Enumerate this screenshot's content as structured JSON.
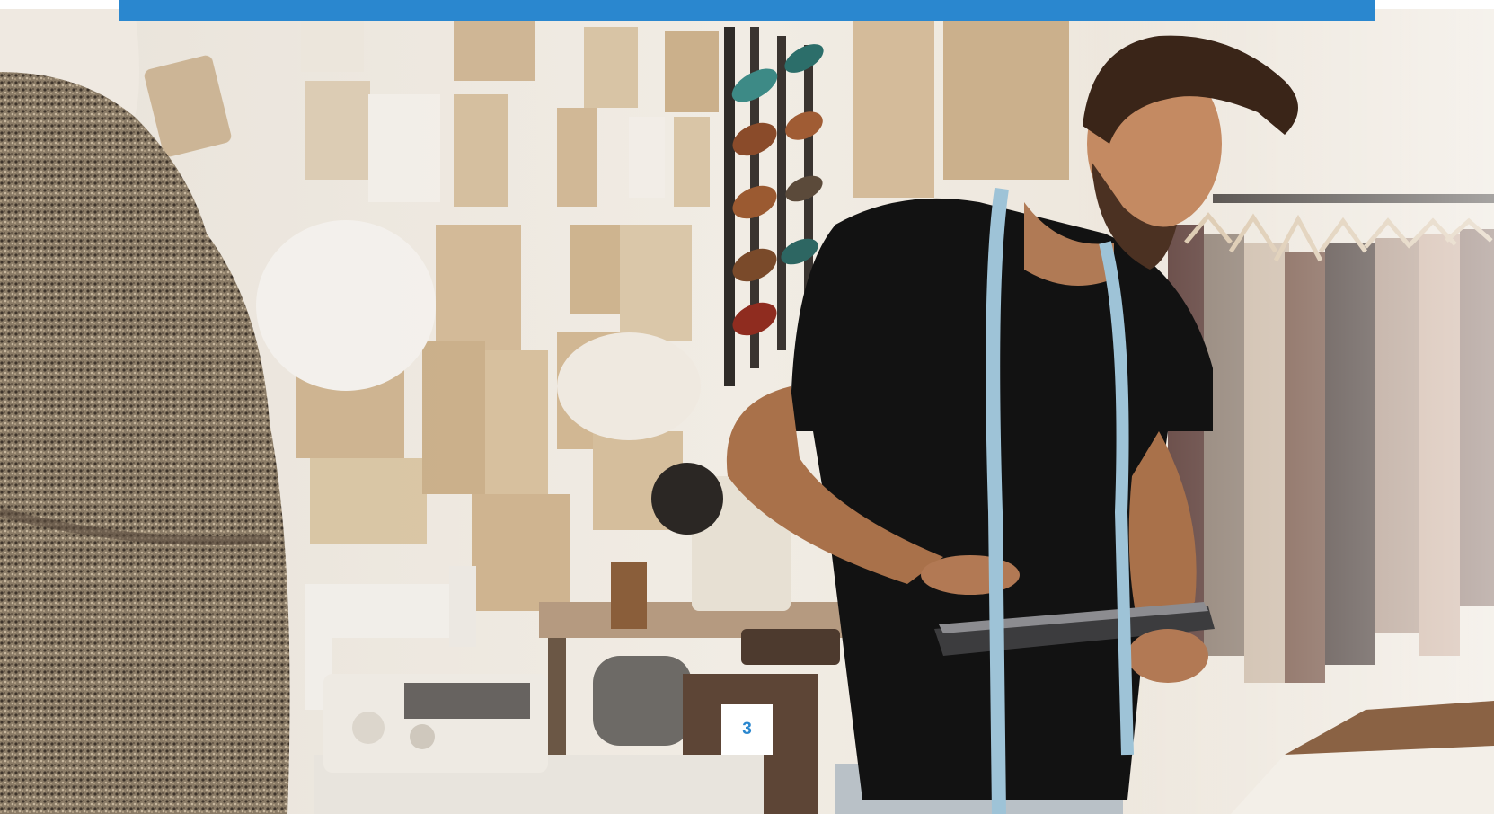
{
  "page": {
    "number": "3"
  },
  "colors": {
    "accent": "#2a87cf",
    "background": "#ffffff"
  },
  "hero_image": {
    "icon": "photo-workshop"
  }
}
